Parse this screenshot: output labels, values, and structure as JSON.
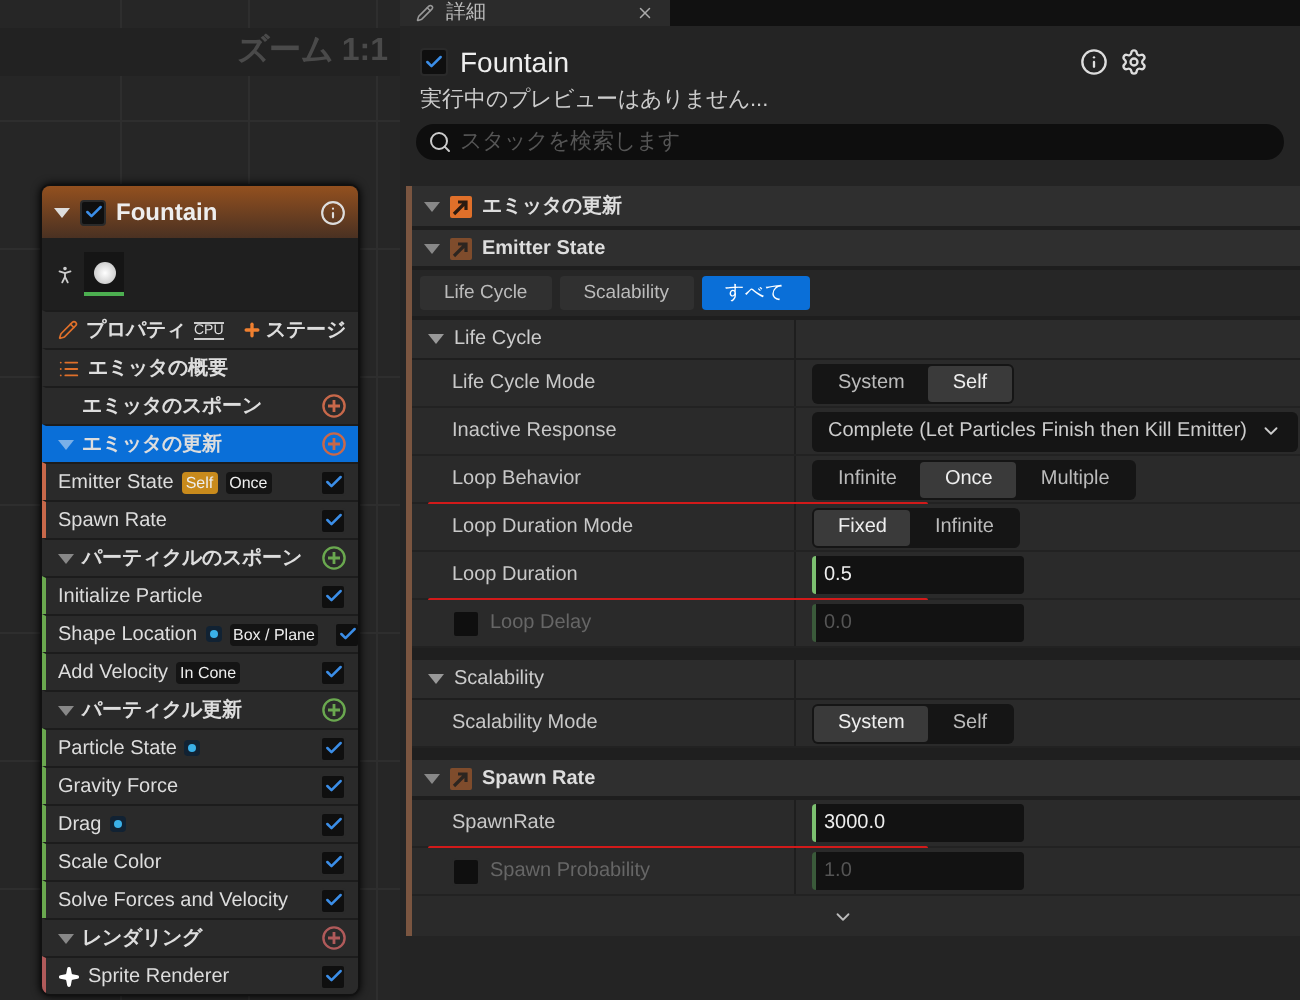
{
  "graph": {
    "zoom_label": "ズーム 1:1"
  },
  "node": {
    "title": "Fountain",
    "enabled": true,
    "properties_label": "プロパティ",
    "sim_target": "CPU",
    "add_stage": "ステージ",
    "overview": "エミッタの概要",
    "groups": [
      {
        "title": "エミッタのスポーン",
        "expanded": false,
        "selected": false,
        "color": "#c8684a"
      },
      {
        "title": "エミッタの更新",
        "expanded": true,
        "selected": true,
        "color": "#c8684a",
        "items": [
          {
            "label": "Emitter State",
            "kind": "module",
            "enabled": true,
            "tags": [
              {
                "kind": "highlight",
                "text": "Self"
              },
              {
                "kind": "plain",
                "text": "Once"
              }
            ]
          },
          {
            "label": "Spawn Rate",
            "kind": "module",
            "enabled": true
          }
        ]
      },
      {
        "title": "パーティクルのスポーン",
        "expanded": true,
        "selected": false,
        "color": "#6aa84f",
        "items": [
          {
            "label": "Initialize Particle",
            "kind": "module",
            "enabled": true
          },
          {
            "label": "Shape Location",
            "kind": "module",
            "enabled": true,
            "tags": [
              {
                "kind": "dot"
              },
              {
                "kind": "plain",
                "text": "Box / Plane"
              }
            ]
          },
          {
            "label": "Add Velocity",
            "kind": "module",
            "enabled": true,
            "tags": [
              {
                "kind": "plain",
                "text": "In Cone"
              }
            ]
          }
        ]
      },
      {
        "title": "パーティクル更新",
        "expanded": true,
        "selected": false,
        "color": "#6aa84f",
        "items": [
          {
            "label": "Particle State",
            "kind": "module",
            "enabled": true,
            "tags": [
              {
                "kind": "dot"
              }
            ]
          },
          {
            "label": "Gravity Force",
            "kind": "module",
            "enabled": true
          },
          {
            "label": "Drag",
            "kind": "module",
            "enabled": true,
            "tags": [
              {
                "kind": "dot"
              }
            ]
          },
          {
            "label": "Scale Color",
            "kind": "module",
            "enabled": true
          },
          {
            "label": "Solve Forces and Velocity",
            "kind": "module",
            "enabled": true
          }
        ]
      },
      {
        "title": "レンダリング",
        "expanded": true,
        "selected": false,
        "color": "#b05a5a",
        "items": [
          {
            "label": "Sprite Renderer",
            "kind": "renderer",
            "enabled": true
          }
        ]
      }
    ]
  },
  "details": {
    "tab": "詳細",
    "title": "Fountain",
    "enabled": true,
    "status": "実行中のプレビューはありません...",
    "search": {
      "placeholder": "スタックを検索します"
    },
    "stack": {
      "title": "エミッタの更新",
      "modules": [
        {
          "title": "Emitter State",
          "filters": [
            {
              "label": "Life Cycle",
              "selected": false
            },
            {
              "label": "Scalability",
              "selected": false
            },
            {
              "label": "すべて",
              "selected": true
            }
          ],
          "categories": [
            {
              "title": "Life Cycle",
              "properties": [
                {
                  "label": "Life Cycle Mode",
                  "kind": "segmented",
                  "options": [
                    {
                      "label": "System",
                      "selected": false
                    },
                    {
                      "label": "Self",
                      "selected": true
                    }
                  ]
                },
                {
                  "label": "Inactive Response",
                  "kind": "dropdown",
                  "value": "Complete (Let Particles Finish then Kill Emitter)"
                },
                {
                  "label": "Loop Behavior",
                  "kind": "segmented",
                  "underlined": true,
                  "options": [
                    {
                      "label": "Infinite",
                      "selected": false
                    },
                    {
                      "label": "Once",
                      "selected": true
                    },
                    {
                      "label": "Multiple",
                      "selected": false
                    }
                  ]
                },
                {
                  "label": "Loop Duration Mode",
                  "kind": "segmented",
                  "options": [
                    {
                      "label": "Fixed",
                      "selected": true
                    },
                    {
                      "label": "Infinite",
                      "selected": false
                    }
                  ]
                },
                {
                  "label": "Loop Duration",
                  "kind": "number",
                  "underlined": true,
                  "value": "0.5"
                },
                {
                  "label": "Loop Delay",
                  "kind": "number",
                  "value": "0.0",
                  "toggle": {
                    "checked": false
                  }
                }
              ]
            },
            {
              "title": "Scalability",
              "properties": [
                {
                  "label": "Scalability Mode",
                  "kind": "segmented",
                  "options": [
                    {
                      "label": "System",
                      "selected": true
                    },
                    {
                      "label": "Self",
                      "selected": false
                    }
                  ]
                }
              ]
            }
          ]
        },
        {
          "title": "Spawn Rate",
          "properties": [
            {
              "label": "SpawnRate",
              "kind": "number",
              "underlined": true,
              "value": "3000.0"
            },
            {
              "label": "Spawn Probability",
              "kind": "number",
              "value": "1.0",
              "toggle": {
                "checked": false
              }
            }
          ]
        }
      ]
    }
  }
}
